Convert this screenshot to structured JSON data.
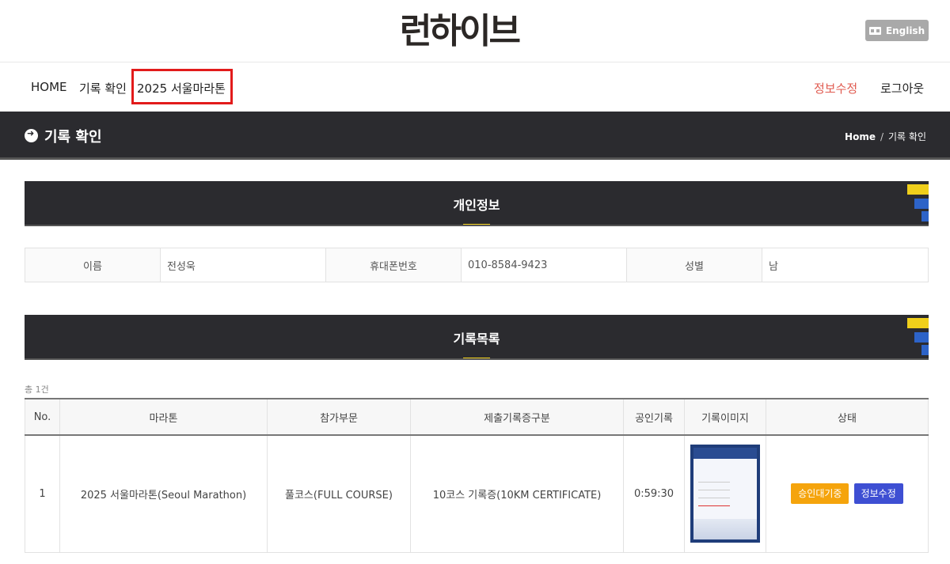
{
  "header": {
    "logo_text": "런하이브",
    "lang_button": "English"
  },
  "nav": {
    "home": "HOME",
    "records": "기록 확인",
    "event": "2025 서울마라톤",
    "edit_info": "정보수정",
    "logout": "로그아웃"
  },
  "page_header": {
    "title": "기록 확인",
    "breadcrumb_home": "Home",
    "breadcrumb_sep": "/",
    "breadcrumb_current": "기록 확인"
  },
  "personal": {
    "section_title": "개인정보",
    "name_label": "이름",
    "name_value": "전성욱",
    "phone_label": "휴대폰번호",
    "phone_value": "010-8584-9423",
    "gender_label": "성별",
    "gender_value": "남"
  },
  "records": {
    "section_title": "기록목록",
    "count": "총 1건",
    "columns": [
      "No.",
      "마라톤",
      "참가부문",
      "제출기록증구분",
      "공인기록",
      "기록이미지",
      "상태"
    ],
    "rows": [
      {
        "no": "1",
        "marathon": "2025 서울마라톤(Seoul Marathon)",
        "division": "풀코스(FULL COURSE)",
        "certificate_type": "10코스 기록증(10KM CERTIFICATE)",
        "official_record": "0:59:30",
        "status_button": "승인대기중",
        "edit_button": "정보수정"
      }
    ]
  },
  "colors": {
    "dark_bar": "#2b2b2f",
    "accent_yellow": "#f0cf1b",
    "accent_blue": "#2d63c8",
    "highlight_red": "#e21b1b",
    "status_orange": "#f5a40c",
    "edit_blue": "#3e4fd3"
  }
}
